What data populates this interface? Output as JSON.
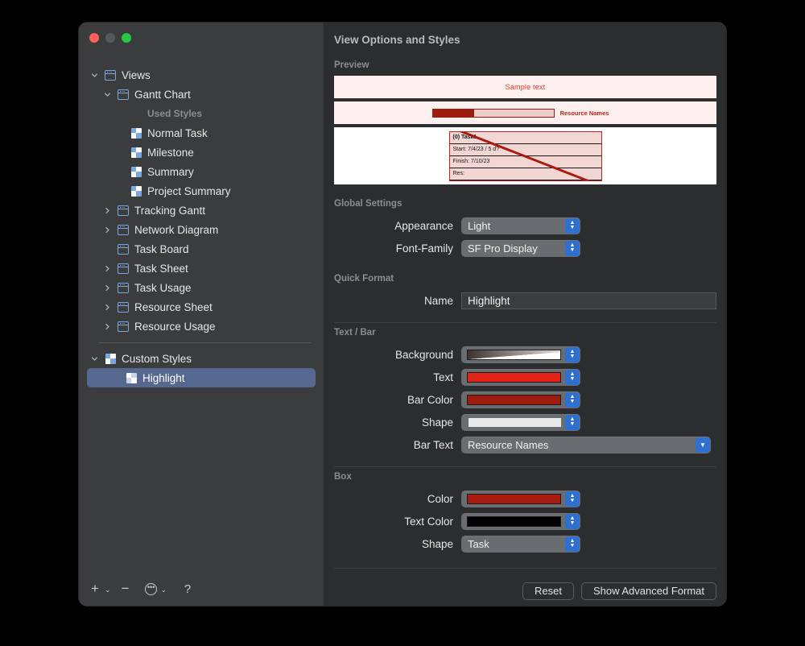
{
  "window": {
    "traffic_lights": [
      "close",
      "minimize",
      "zoom"
    ]
  },
  "sidebar": {
    "items": [
      {
        "label": "Views",
        "icon": "view-icon",
        "indent": 0,
        "disclosure": "expanded"
      },
      {
        "label": "Gantt Chart",
        "icon": "view-icon",
        "indent": 1,
        "disclosure": "expanded"
      },
      {
        "label": "Used Styles",
        "icon": "none",
        "indent": 2,
        "disclosure": "none",
        "group": true
      },
      {
        "label": "Normal Task",
        "icon": "style-icon",
        "indent": 2,
        "disclosure": "none"
      },
      {
        "label": "Milestone",
        "icon": "style-icon",
        "indent": 2,
        "disclosure": "none"
      },
      {
        "label": "Summary",
        "icon": "style-icon",
        "indent": 2,
        "disclosure": "none"
      },
      {
        "label": "Project Summary",
        "icon": "style-icon",
        "indent": 2,
        "disclosure": "none"
      },
      {
        "label": "Tracking Gantt",
        "icon": "view-icon",
        "indent": 1,
        "disclosure": "collapsed"
      },
      {
        "label": "Network Diagram",
        "icon": "view-icon",
        "indent": 1,
        "disclosure": "collapsed"
      },
      {
        "label": "Task Board",
        "icon": "view-icon",
        "indent": 1,
        "disclosure": "none"
      },
      {
        "label": "Task Sheet",
        "icon": "view-icon",
        "indent": 1,
        "disclosure": "collapsed"
      },
      {
        "label": "Task Usage",
        "icon": "view-icon",
        "indent": 1,
        "disclosure": "collapsed"
      },
      {
        "label": "Resource Sheet",
        "icon": "view-icon",
        "indent": 1,
        "disclosure": "collapsed"
      },
      {
        "label": "Resource Usage",
        "icon": "view-icon",
        "indent": 1,
        "disclosure": "collapsed"
      }
    ],
    "custom_section": [
      {
        "label": "Custom Styles",
        "icon": "style-icon",
        "indent": 0,
        "disclosure": "expanded",
        "selected": false
      },
      {
        "label": "Highlight",
        "icon": "style-icon",
        "indent": 1,
        "disclosure": "none",
        "selected": true
      }
    ],
    "toolbar": {
      "add_label": "+",
      "add_chevron": "⌄",
      "remove_label": "−",
      "action_label": "•••",
      "action_chevron": "⌄",
      "help_label": "?"
    }
  },
  "detail": {
    "title": "View Options and Styles",
    "sections": {
      "preview": "Preview",
      "global_settings": "Global Settings",
      "quick_format": "Quick Format",
      "text_bar": "Text / Bar",
      "box": "Box"
    },
    "preview": {
      "sample_text": "Sample text",
      "bar_label": "Resource Names",
      "bar_fill_percent": 34,
      "task_box": {
        "line1": "(0) Task1",
        "line2": "Start: 7/4/23 / 5 d?",
        "line3": "Finish: 7/10/23",
        "line4": "Res:"
      }
    },
    "global_settings": {
      "appearance_label": "Appearance",
      "appearance_value": "Light",
      "font_family_label": "Font-Family",
      "font_family_value": "SF Pro Display"
    },
    "quick_format": {
      "name_label": "Name",
      "name_value": "Highlight"
    },
    "text_bar": {
      "background_label": "Background",
      "text_label": "Text",
      "bar_color_label": "Bar Color",
      "shape_label": "Shape",
      "bar_text_label": "Bar Text",
      "bar_text_value": "Resource Names"
    },
    "box": {
      "color_label": "Color",
      "text_color_label": "Text Color",
      "shape_label": "Shape",
      "shape_value": "Task"
    },
    "footer": {
      "reset_label": "Reset",
      "advanced_label": "Show Advanced Format"
    }
  },
  "colors": {
    "accent_blue": "#2f6fd0",
    "selection_blue": "#56688f",
    "text_red": "#e8342a",
    "bar_red": "#9e1b10",
    "box_red": "#c0241a",
    "box_text_black": "#000000",
    "shape_white": "#e9e9e9",
    "preview_bg": "#fdf0ee",
    "background_gradient_from": "#3a332f",
    "background_gradient_to": "#ffffff",
    "sidebar_bg": "#3a3c3e",
    "detail_bg": "#2b2d2f"
  }
}
